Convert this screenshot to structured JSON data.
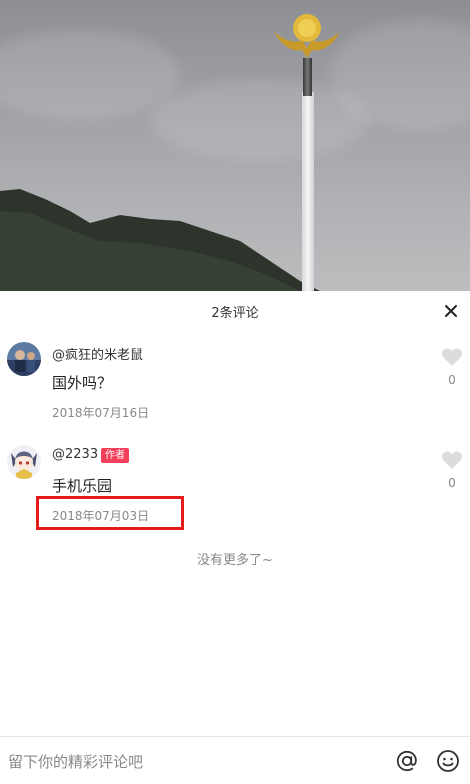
{
  "panel": {
    "title": "2条评论",
    "no_more": "没有更多了~"
  },
  "comments": [
    {
      "username": "@疯狂的米老鼠",
      "text": "国外吗？",
      "date": "2018年07月16日",
      "likes": "0",
      "is_author": false
    },
    {
      "username": "@2233",
      "badge": "作者",
      "text": "手机乐园",
      "date": "2018年07月03日",
      "likes": "0",
      "is_author": true
    }
  ],
  "input": {
    "placeholder": "留下你的精彩评论吧"
  },
  "icons": {
    "close": "close-icon",
    "like": "heart-icon",
    "mention": "at-icon",
    "emoji": "emoji-icon"
  },
  "colors": {
    "badge": "#f23f5a",
    "highlight": "#e31b1b",
    "secondary_text": "#888888"
  }
}
